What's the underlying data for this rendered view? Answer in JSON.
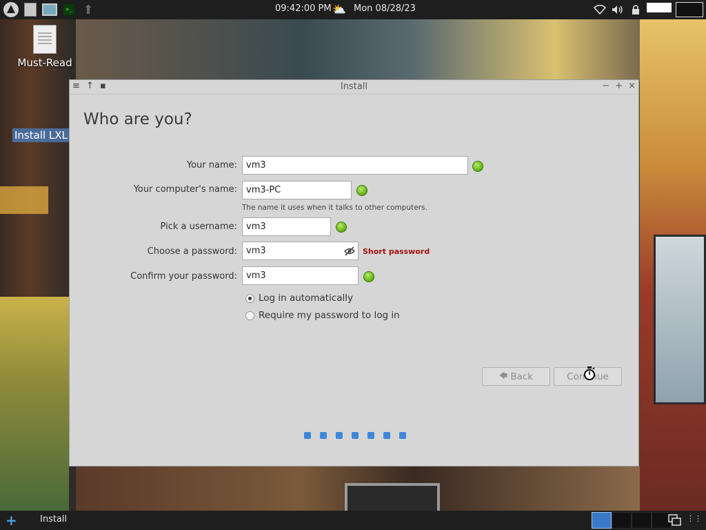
{
  "top_panel": {
    "clock": "09:42:00 PM",
    "date": "Mon 08/28/23",
    "icons": [
      "lxqt-menu-icon",
      "file-manager-icon",
      "monitor-icon",
      "terminal-icon",
      "upload-arrow-icon"
    ],
    "tray_icons": [
      "wifi-icon",
      "volume-icon",
      "lock-icon",
      "network-graph-icon",
      "cpu-graph-icon"
    ]
  },
  "desktop": {
    "icons": [
      {
        "label": "Must-Read",
        "icon": "document-icon"
      },
      {
        "label": "Install LXL"
      }
    ]
  },
  "window": {
    "title": "Install",
    "heading": "Who are you?",
    "fields": {
      "name": {
        "label": "Your name:",
        "value": "vm3"
      },
      "computer": {
        "label": "Your computer's name:",
        "value": "vm3-PC",
        "hint": "The name it uses when it talks to other computers."
      },
      "username": {
        "label": "Pick a username:",
        "value": "vm3"
      },
      "password": {
        "label": "Choose a password:",
        "value": "vm3",
        "warning": "Short password"
      },
      "confirm": {
        "label": "Confirm your password:",
        "value": "vm3"
      }
    },
    "options": {
      "login_auto": "Log in automatically",
      "require_password": "Require my password to log in",
      "selected": "login_auto"
    },
    "buttons": {
      "back": "Back",
      "continue": "Continue"
    },
    "progress": {
      "total_steps": 7,
      "current_step": 7
    }
  },
  "taskbar": {
    "task": "Install",
    "desktops": 4,
    "active_desktop": 1
  },
  "colors": {
    "ok_indicator": "#5fae14",
    "warning": "#a31212",
    "progress_dot": "#3f86d8",
    "panel_bg": "#1e1e1e"
  }
}
